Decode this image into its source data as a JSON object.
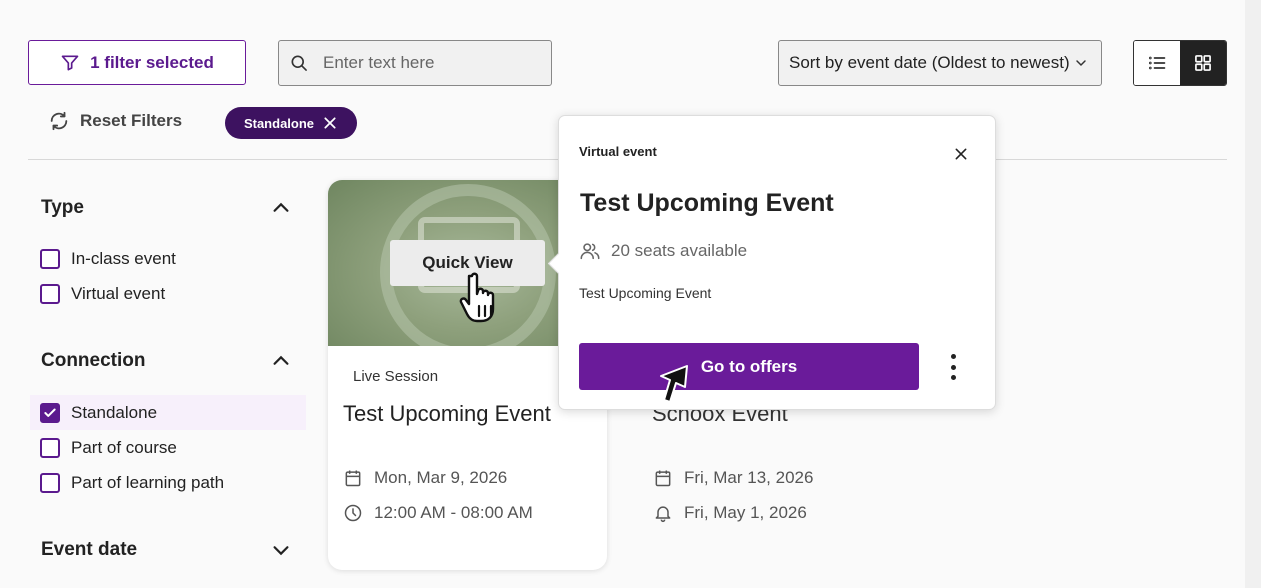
{
  "toolbar": {
    "filter_label": "1 filter selected",
    "search_placeholder": "Enter text here",
    "sort_label": "Sort by event date (Oldest to newest)",
    "reset_label": "Reset Filters",
    "active_chip": "Standalone"
  },
  "sidebar": {
    "sections": [
      {
        "title": "Type",
        "expanded": true,
        "options": [
          {
            "label": "In-class event",
            "checked": false
          },
          {
            "label": "Virtual event",
            "checked": false
          }
        ]
      },
      {
        "title": "Connection",
        "expanded": true,
        "options": [
          {
            "label": "Standalone",
            "checked": true
          },
          {
            "label": "Part of course",
            "checked": false
          },
          {
            "label": "Part of learning path",
            "checked": false
          }
        ]
      },
      {
        "title": "Event date",
        "expanded": false,
        "options": []
      }
    ]
  },
  "cards": [
    {
      "quick_view": "Quick View",
      "tag": "Live Session",
      "title": "Test Upcoming Event",
      "date": "Mon, Mar 9, 2026",
      "time": "12:00 AM - 08:00 AM"
    },
    {
      "title": "Schoox Event",
      "date": "Fri, Mar 13, 2026",
      "reminder": "Fri, May 1, 2026"
    }
  ],
  "popover": {
    "type": "Virtual event",
    "title": "Test Upcoming Event",
    "seats": "20 seats available",
    "description": "Test Upcoming Event",
    "cta": "Go to offers"
  },
  "colors": {
    "accent": "#6a1b9a",
    "chip": "#3d1260"
  },
  "icons": [
    "filter-icon",
    "search-icon",
    "chevron-down-icon",
    "list-view-icon",
    "grid-view-icon",
    "refresh-icon",
    "close-icon",
    "chevron-up-icon",
    "check-icon",
    "calendar-icon",
    "clock-icon",
    "bell-icon",
    "users-icon",
    "more-vertical-icon",
    "hand-cursor-icon",
    "pointer-cursor-icon"
  ]
}
